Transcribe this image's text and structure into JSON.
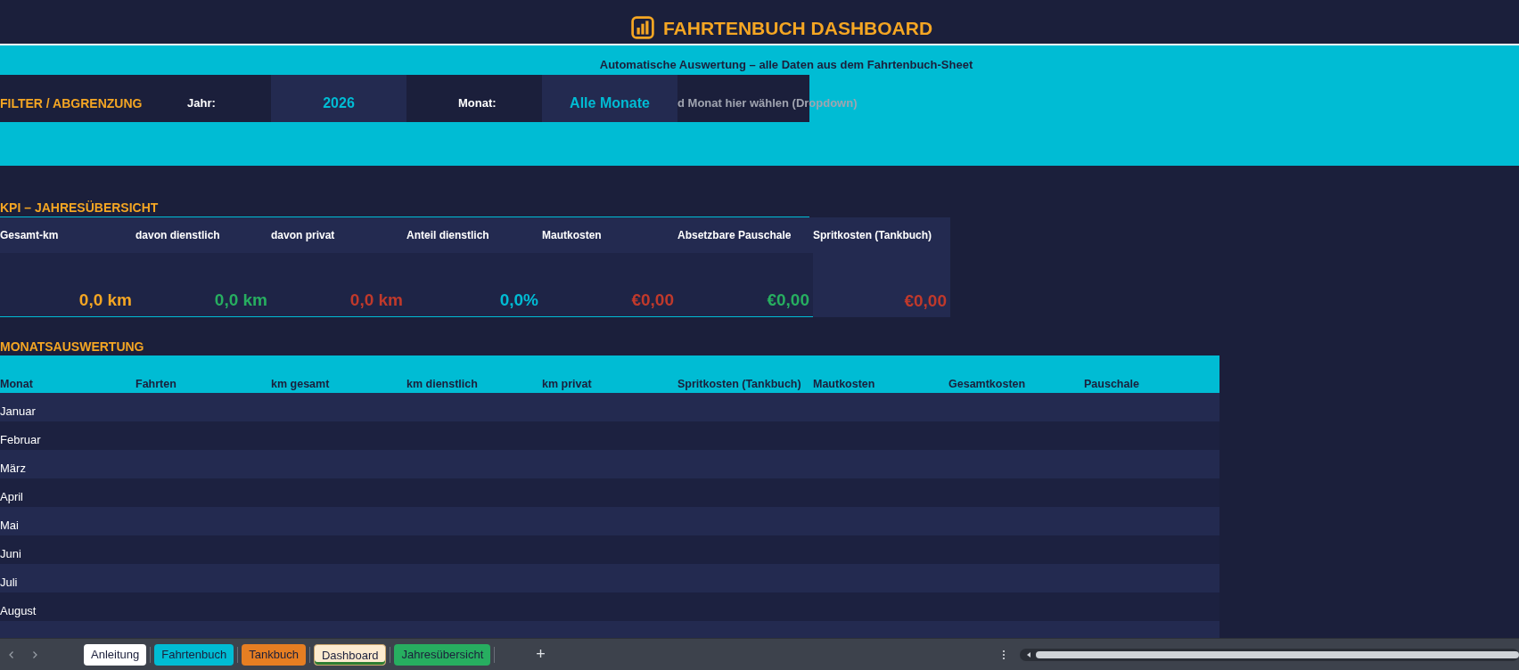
{
  "title": "FAHRTENBUCH DASHBOARD",
  "subtitle": "Automatische Auswertung – alle Daten aus dem Fahrtenbuch-Sheet",
  "filter": {
    "heading": "FILTER / ABGRENZUNG",
    "year_label": "Jahr:",
    "year_value": "2026",
    "month_label": "Monat:",
    "month_value": "Alle Monate",
    "hint": "d Monat hier wählen (Dropdown)"
  },
  "kpi": {
    "heading": "KPI – JAHRESÜBERSICHT",
    "items": [
      {
        "label": "Gesamt-km",
        "value": "0,0 km",
        "color": "#f5a623"
      },
      {
        "label": "davon dienstlich",
        "value": "0,0 km",
        "color": "#27ae60"
      },
      {
        "label": "davon privat",
        "value": "0,0 km",
        "color": "#c0392b"
      },
      {
        "label": "Anteil dienstlich",
        "value": "0,0%",
        "color": "#00bcd4"
      },
      {
        "label": "Mautkosten",
        "value": "€0,00",
        "color": "#c0392b"
      },
      {
        "label": "Absetzbare Pauschale",
        "value": "€0,00",
        "color": "#27ae60"
      },
      {
        "label": "Spritkosten (Tankbuch)",
        "value": "€0,00",
        "color": "#c0392b"
      }
    ]
  },
  "monthly": {
    "heading": "MONATSAUSWERTUNG",
    "columns": [
      "Monat",
      "Fahrten",
      "km gesamt",
      "km dienstlich",
      "km privat",
      "Spritkosten (Tankbuch)",
      "Mautkosten",
      "Gesamtkosten",
      "Pauschale"
    ],
    "rows": [
      "Januar",
      "Februar",
      "März",
      "April",
      "Mai",
      "Juni",
      "Juli",
      "August"
    ]
  },
  "sheet_tabs": [
    {
      "label": "Anleitung",
      "color": "#ffffff",
      "selected": false
    },
    {
      "label": "Fahrtenbuch",
      "color": "#00bcd4",
      "selected": false
    },
    {
      "label": "Tankbuch",
      "color": "#e67e22",
      "selected": false
    },
    {
      "label": "Dashboard",
      "color": "#fdebd0",
      "selected": true
    },
    {
      "label": "Jahresübersicht",
      "color": "#27ae60",
      "selected": false
    }
  ],
  "add_sheet": "+"
}
